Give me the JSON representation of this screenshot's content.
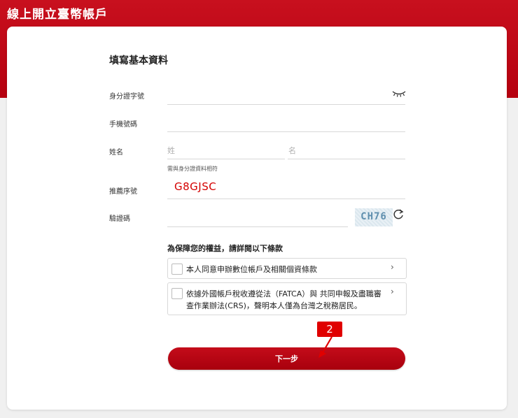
{
  "header": {
    "title": "線上開立臺幣帳戶"
  },
  "form": {
    "title": "填寫基本資料",
    "id_label": "身分證字號",
    "id_value": "",
    "mobile_label": "手機號碼",
    "mobile_value": "",
    "name_label": "姓名",
    "surname_placeholder": "姓",
    "given_name_placeholder": "名",
    "name_hint": "需與身分證資料相符",
    "referral_label": "推薦序號",
    "referral_value": "G8GJSC",
    "captcha_label": "驗證碼",
    "captcha_value": "",
    "captcha_text": "CH76"
  },
  "terms": {
    "title": "為保障您的權益，請詳閱以下條款",
    "items": [
      {
        "label": "本人同意申辦數位帳戶及相關個資條款",
        "checked": false
      },
      {
        "label_line1": "依據外國帳戶稅收遵從法（FATCA）與 共同申報及盡職審",
        "label_line2": "查作業辦法(CRS)，聲明本人僅為台灣之稅務居民。",
        "checked": false
      }
    ]
  },
  "actions": {
    "next_label": "下一步"
  },
  "annotation": {
    "step_number": "2"
  },
  "colors": {
    "brand_red": "#c8101e",
    "referral_red": "#d40000"
  }
}
